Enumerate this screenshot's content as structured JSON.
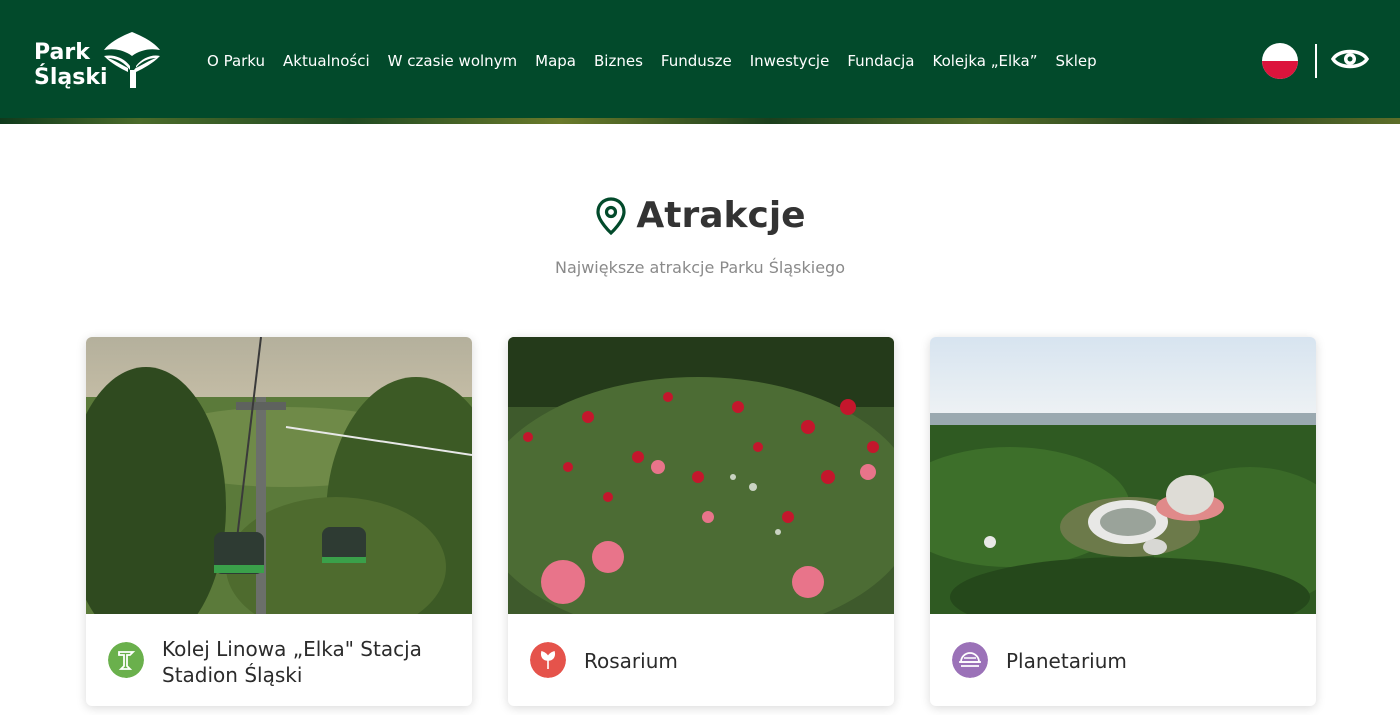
{
  "header": {
    "logo": {
      "line1": "Park",
      "line2": "Śląski"
    },
    "nav": [
      "O Parku",
      "Aktualności",
      "W czasie wolnym",
      "Mapa",
      "Biznes",
      "Fundusze",
      "Inwestycje",
      "Fundacja",
      "Kolejka „Elka”",
      "Sklep"
    ],
    "language_flag": "polish-flag-icon",
    "accessibility_icon": "eye-icon"
  },
  "section": {
    "title": "Atrakcje",
    "subtitle": "Największe atrakcje Parku Śląskiego",
    "icon": "location-pin-icon"
  },
  "cards": [
    {
      "label": "Kolej Linowa „Elka\" Stacja Stadion Śląski",
      "icon": "cable-car-icon",
      "icon_color": "#6ab04c"
    },
    {
      "label": "Rosarium",
      "icon": "rose-icon",
      "icon_color": "#e5534b"
    },
    {
      "label": "Planetarium",
      "icon": "planetarium-icon",
      "icon_color": "#9b72b8"
    }
  ],
  "colors": {
    "brand_green": "#024a2b",
    "title_text": "#333333",
    "subtitle_text": "#8a8a8a"
  }
}
